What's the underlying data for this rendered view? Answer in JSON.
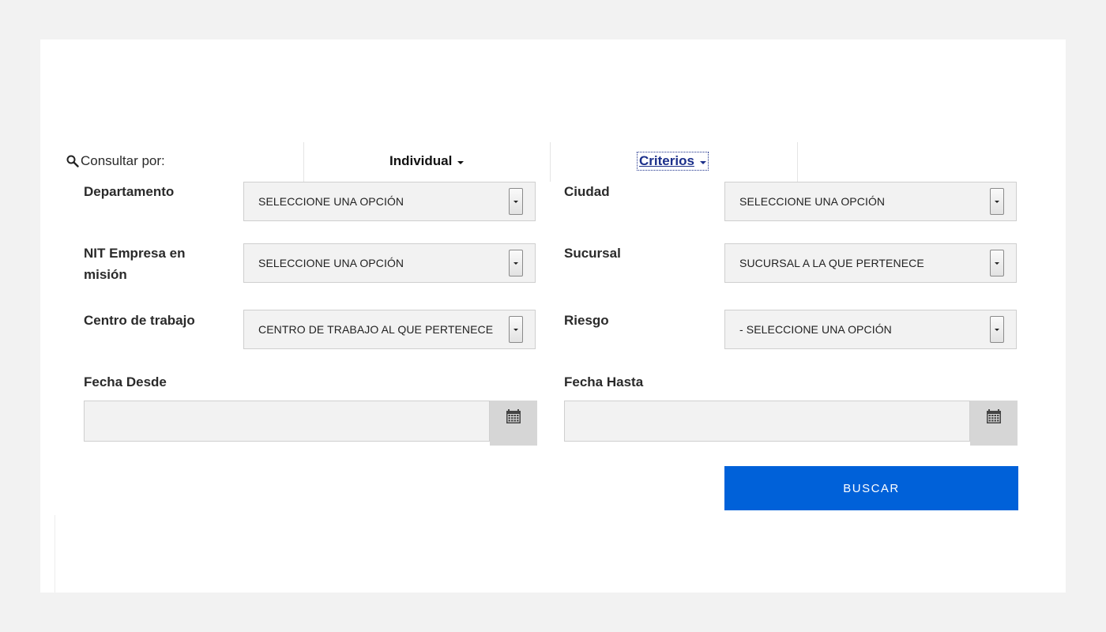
{
  "consult": {
    "label": "Consultar por:"
  },
  "tabs": {
    "individual": "Individual",
    "criterios": "Criterios"
  },
  "fields": {
    "departamento": {
      "label": "Departamento",
      "value": "SELECCIONE UNA OPCIÓN"
    },
    "ciudad": {
      "label": "Ciudad",
      "value": "SELECCIONE UNA OPCIÓN"
    },
    "nit": {
      "label": "NIT Empresa en misión",
      "value": "SELECCIONE UNA OPCIÓN"
    },
    "sucursal": {
      "label": "Sucursal",
      "value": "SUCURSAL A LA QUE PERTENECE"
    },
    "centro": {
      "label": "Centro de trabajo",
      "value": "CENTRO DE TRABAJO AL QUE PERTENECE"
    },
    "riesgo": {
      "label": "Riesgo",
      "value": "- SELECCIONE UNA OPCIÓN"
    },
    "fecha_desde": {
      "label": "Fecha Desde",
      "value": ""
    },
    "fecha_hasta": {
      "label": "Fecha Hasta",
      "value": ""
    }
  },
  "actions": {
    "buscar": "BUSCAR"
  },
  "colors": {
    "primary": "#0061d9",
    "link": "#1b2f8a",
    "field_bg": "#f2f2f2",
    "page_bg": "#f2f2f2"
  },
  "icons": {
    "search": "search-icon",
    "calendar": "calendar-icon",
    "caret": "caret-down-icon"
  }
}
